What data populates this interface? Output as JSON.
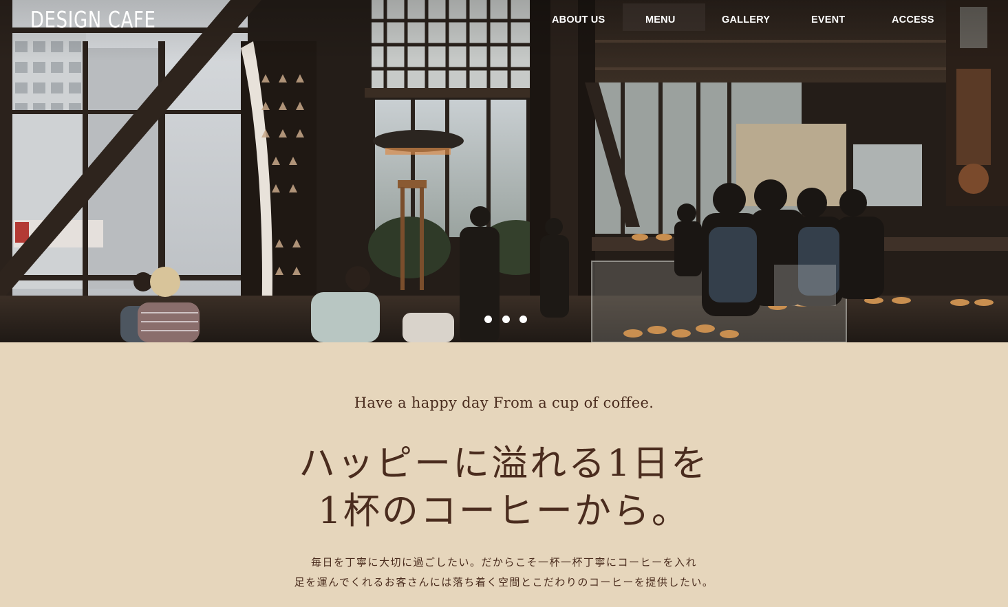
{
  "header": {
    "logo": "DESIGN CAFE",
    "nav": [
      {
        "label": "ABOUT US"
      },
      {
        "label": "MENU"
      },
      {
        "label": "GALLERY"
      },
      {
        "label": "EVENT"
      },
      {
        "label": "ACCESS"
      }
    ]
  },
  "hero": {
    "image_description_icon": "cafe-interior-photo",
    "slides": 3
  },
  "intro": {
    "tagline": "Have a happy day From a cup of coffee.",
    "headline_line1": "ハッピーに溢れる1日を",
    "headline_line2": "1杯のコーヒーから。",
    "body_line1": "毎日を丁寧に大切に過ごしたい。だからこそ一杯一杯丁寧にコーヒーを入れ",
    "body_line2": "足を運んでくれるお客さんには落ち着く空間とこだわりのコーヒーを提供したい。"
  },
  "colors": {
    "background": "#e6d6bc",
    "text_brown": "#4a2c1e",
    "hero_dark": "#1d1915"
  }
}
